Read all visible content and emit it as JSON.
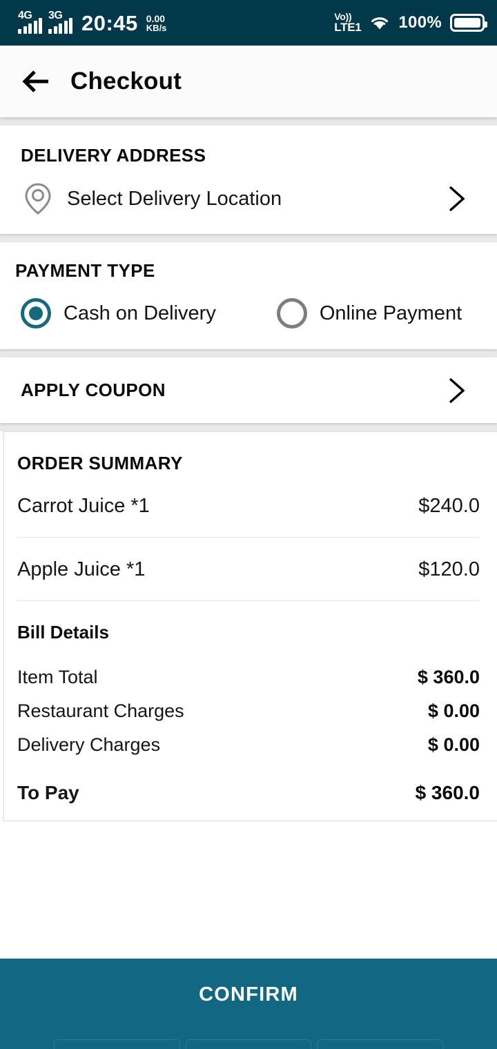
{
  "status_bar": {
    "network_1": "4G",
    "network_2": "3G",
    "time": "20:45",
    "data_speed_value": "0.00",
    "data_speed_unit": "KB/s",
    "volte_top": "Vo))",
    "volte_bottom": "LTE1",
    "battery_percent": "100%",
    "bg_color": "#01384a"
  },
  "app_bar": {
    "title": "Checkout",
    "back_icon": "arrow-left-icon"
  },
  "delivery": {
    "section_title": "DELIVERY ADDRESS",
    "location_icon": "map-pin-icon",
    "value": "Select Delivery Location",
    "chevron_icon": "chevron-right-icon"
  },
  "payment": {
    "section_title": "PAYMENT TYPE",
    "options": [
      {
        "label": "Cash on Delivery",
        "selected": true
      },
      {
        "label": "Online Payment",
        "selected": false
      }
    ],
    "selected_color": "#16697f",
    "unselected_color": "#7d7d7d"
  },
  "coupon": {
    "title": "APPLY COUPON",
    "chevron_icon": "chevron-right-icon"
  },
  "order_summary": {
    "title": "ORDER SUMMARY",
    "items": [
      {
        "name": "Carrot Juice *1",
        "price": "$240.0"
      },
      {
        "name": "Apple Juice *1",
        "price": "$120.0"
      }
    ],
    "bill_title": "Bill Details",
    "bill_rows": [
      {
        "label": "Item Total",
        "value": "$ 360.0"
      },
      {
        "label": "Restaurant Charges",
        "value": "$ 0.00"
      },
      {
        "label": "Delivery Charges",
        "value": "$ 0.00"
      }
    ],
    "total": {
      "label": "To Pay",
      "value": "$ 360.0"
    }
  },
  "confirm_button": {
    "label": "CONFIRM",
    "bg_color": "#126883",
    "text_color": "#ffffff"
  }
}
